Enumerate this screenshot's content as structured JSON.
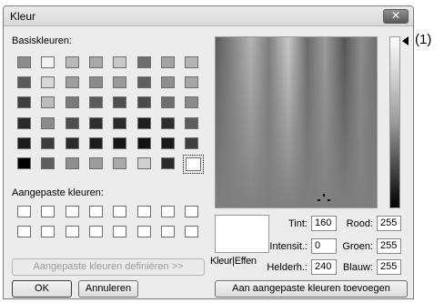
{
  "dialog": {
    "title": "Kleur",
    "close_icon": "close-icon"
  },
  "basic_colors": {
    "label": "Basiskleuren:",
    "rows": [
      [
        "#8c8c8c",
        "#f2f2f2",
        "#b8b8b8",
        "#a8a8a8",
        "#c8c8c8",
        "#6e6e6e",
        "#a2a2a2",
        "#b4b4b4"
      ],
      [
        "#5a5a5a",
        "#d8d8d8",
        "#9e9e9e",
        "#8a8a8a",
        "#9a9a9a",
        "#5e5e5e",
        "#8e8e8e",
        "#a6a6a6"
      ],
      [
        "#3e3e3e",
        "#bcbcbc",
        "#7a7a7a",
        "#5a5a5a",
        "#4e4e4e",
        "#4a4a4a",
        "#6e6e6e",
        "#8a8a8a"
      ],
      [
        "#2a2a2a",
        "#8c8c8c",
        "#4e4e4e",
        "#2e2e2e",
        "#2a2a2a",
        "#1e1e1e",
        "#2e2e2e",
        "#5e5e5e"
      ],
      [
        "#1c1c1c",
        "#3c3c3c",
        "#2a2a2a",
        "#1c1c1c",
        "#161616",
        "#121212",
        "#1a1a1a",
        "#3e3e3e"
      ],
      [
        "#000000",
        "#5e5e5e",
        "#8e8e8e",
        "#9c9c9c",
        "#a8a8a8",
        "#cfcfcf",
        "#2a2a2a",
        "#ffffff"
      ]
    ],
    "selected": "row6-col8"
  },
  "custom_colors": {
    "label": "Aangepaste kleuren:"
  },
  "buttons": {
    "define_custom": "Aangepaste kleuren definiëren >>",
    "ok": "OK",
    "cancel": "Annuleren",
    "add_custom": "Aan aangepaste kleuren toevoegen"
  },
  "preview": {
    "label": "Kleur|Effen"
  },
  "fields": {
    "hue_label": "Tint:",
    "hue": "160",
    "sat_label": "Intensit.:",
    "sat": "0",
    "lum_label": "Helderh.:",
    "lum": "240",
    "red_label": "Rood:",
    "red": "255",
    "green_label": "Groen:",
    "green": "255",
    "blue_label": "Blauw:",
    "blue": "255"
  },
  "annotation": {
    "callout": "(1)"
  }
}
